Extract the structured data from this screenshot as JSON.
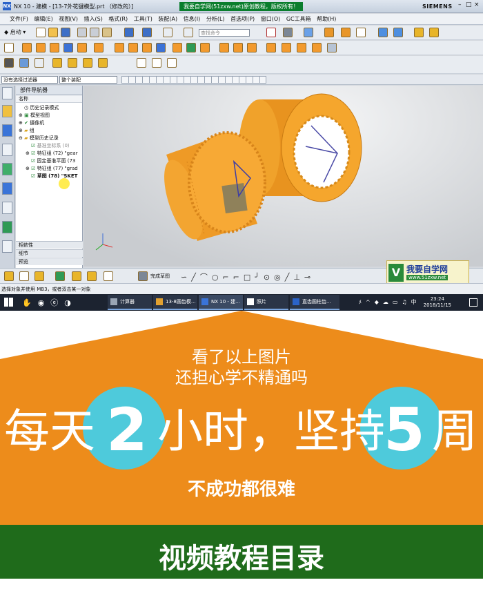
{
  "window": {
    "title": "NX 10 - 建模 - [13-7外花键模型.prt （修改的）]",
    "watermark": "我要自学网(51zxw.net)原创教程，版权所有！",
    "brand": "SIEMENS"
  },
  "menu": [
    "文件(F)",
    "编辑(E)",
    "视图(V)",
    "插入(S)",
    "格式(R)",
    "工具(T)",
    "装配(A)",
    "信息(I)",
    "分析(L)",
    "首选项(P)",
    "窗口(O)",
    "GC工具箱",
    "帮助(H)"
  ],
  "toolbar": {
    "start_label": "启动",
    "search_placeholder": "查找命令"
  },
  "filters": {
    "selection_filter": "没有选择过滤器",
    "assembly_scope": "整个装配"
  },
  "navigator": {
    "title": "部件导航器",
    "column_name": "名称",
    "rows": [
      "历史记录模式",
      "模型视图",
      "摄像机",
      "组",
      "模型历史记录",
      "基准坐标系 (0)",
      "特征组 (72) \"gear",
      "固定基准平面 (73",
      "特征组 (77) \"grad",
      "草图 (78) \"SKET"
    ],
    "sections": [
      "相依性",
      "细节",
      "预览"
    ]
  },
  "bottom_toolbar": {
    "finish_sketch": "完成草图"
  },
  "status_bar": {
    "message": "选择对象并使用 MB3，或者双击某一对象"
  },
  "taskbar": {
    "items": [
      "计算器",
      "13-8圆齿模...",
      "NX 10 - 建...",
      "照片",
      "直齿圆柱齿..."
    ],
    "time": "23:24",
    "date": "2018/11/15"
  },
  "corner_logo": {
    "text": "我要自学网",
    "url": "www.51zxw.net"
  },
  "promo": {
    "line1": "看了以上图片",
    "line2": "还担心学不精通吗",
    "big_prefix": "每天",
    "big_num1": "2",
    "big_mid": "小时，坚持",
    "big_num2": "5",
    "big_suffix": "周",
    "line4": "不成功都很难",
    "colors": {
      "orange": "#ed8c1b",
      "cyan": "#4ecadb",
      "green": "#1f6b1b"
    }
  },
  "section_title": "视频教程目录"
}
